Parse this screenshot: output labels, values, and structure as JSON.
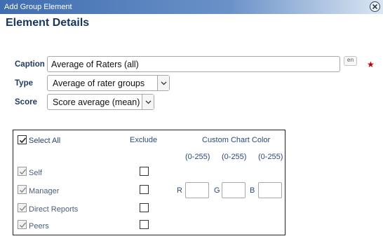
{
  "dialog": {
    "title": "Add Group Element"
  },
  "heading": "Element Details",
  "form": {
    "caption_label": "Caption",
    "caption_value": "Average of Raters (all)",
    "lang_badge": "en",
    "required_marker": "★",
    "type_label": "Type",
    "type_value": "Average of rater groups",
    "score_label": "Score",
    "score_value": "Score average (mean)"
  },
  "groups": {
    "select_all_label": "Select All",
    "exclude_header": "Exclude",
    "color_header": "Custom Chart Color",
    "range_labels": [
      "(0-255)",
      "(0-255)",
      "(0-255)"
    ],
    "channel_labels": [
      "R",
      "G",
      "B"
    ],
    "channel_values": [
      "",
      "",
      ""
    ],
    "rows": [
      {
        "label": "Self",
        "checked": true,
        "exclude": false
      },
      {
        "label": "Manager",
        "checked": true,
        "exclude": false
      },
      {
        "label": "Direct Reports",
        "checked": true,
        "exclude": false
      },
      {
        "label": "Peers",
        "checked": true,
        "exclude": false
      }
    ]
  }
}
